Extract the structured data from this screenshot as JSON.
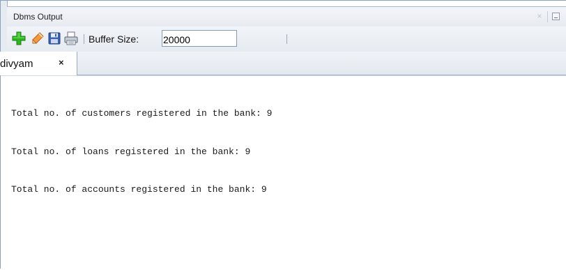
{
  "window": {
    "title": "Dbms Output",
    "close_label": "×"
  },
  "toolbar": {
    "buffer_label": "Buffer Size:",
    "buffer_value": "20000",
    "icons": [
      "add-icon",
      "eraser-icon",
      "save-icon",
      "print-icon"
    ]
  },
  "tabs": [
    {
      "label": "divyam",
      "close_label": "×",
      "active": true
    }
  ],
  "output": {
    "lines": [
      "Total no. of customers registered in the bank: 9",
      "Total no. of loans registered in the bank: 9",
      "Total no. of accounts registered in the bank: 9"
    ]
  },
  "colors": {
    "add_icon": "#2db51e",
    "eraser_icon": "#e8872a",
    "save_icon": "#3a63b8",
    "chrome_bg": "#e7ebf1",
    "border": "#8aa0bd"
  }
}
